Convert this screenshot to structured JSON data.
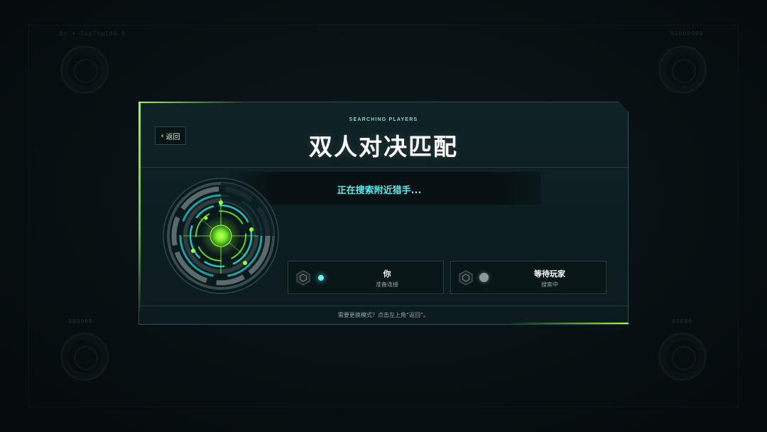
{
  "background": {
    "top_left_label": "Br • TopTop100 5",
    "top_right_label": "00000000",
    "bottom_left_label": "000000",
    "bottom_right_label": "00000"
  },
  "header": {
    "subtitle": "SEARCHING PLAYERS",
    "title": "双人对决匹配",
    "back_label": "返回"
  },
  "status": {
    "text": "正在搜索附近猎手..."
  },
  "players": [
    {
      "name": "你",
      "status": "准备连接",
      "state": "active",
      "icon": "hex-badge-icon"
    },
    {
      "name": "等待玩家",
      "status": "搜索中",
      "state": "idle",
      "icon": "hex-badge-icon"
    }
  ],
  "footer": {
    "hint": "需要更换模式？点击左上角“返回”。"
  },
  "colors": {
    "accent_green": "#9bff3c",
    "accent_cyan": "#5ee8e8",
    "panel_bg": "#0d1f22"
  }
}
